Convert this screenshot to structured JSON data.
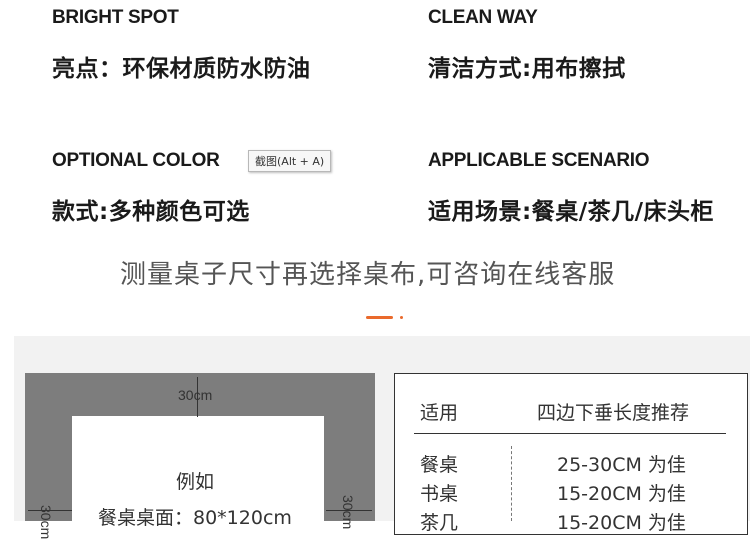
{
  "features": {
    "bright_spot": {
      "label": "BRIGHT SPOT",
      "value": "亮点：环保材质防水防油"
    },
    "clean_way": {
      "label": "CLEAN WAY",
      "value": "清洁方式:用布擦拭"
    },
    "optional_color": {
      "label": "OPTIONAL COLOR",
      "value": "款式:多种颜色可选"
    },
    "applicable_scenario": {
      "label": "APPLICABLE SCENARIO",
      "value": "适用场景:餐桌/茶几/床头柜"
    }
  },
  "screenshot_tooltip": "截图(Alt + A)",
  "headline": "测量桌子尺寸再选择桌布,可咨询在线客服",
  "colors": {
    "accent": "#ea6a2c",
    "table_frame": "#7d7d7d",
    "panel_bg": "#f2f2f2"
  },
  "diagram": {
    "top_dimension": "30cm",
    "left_dimension": "30cm",
    "right_dimension": "30cm",
    "example_title": "例如",
    "example_size": "餐桌桌面：80*120cm"
  },
  "recommendation_table": {
    "headers": [
      "适用",
      "四边下垂长度推荐"
    ],
    "rows": [
      {
        "use": "餐桌",
        "length": "25-30CM 为佳"
      },
      {
        "use": "书桌",
        "length": "15-20CM 为佳"
      },
      {
        "use": "茶几",
        "length": "15-20CM 为佳"
      }
    ]
  }
}
